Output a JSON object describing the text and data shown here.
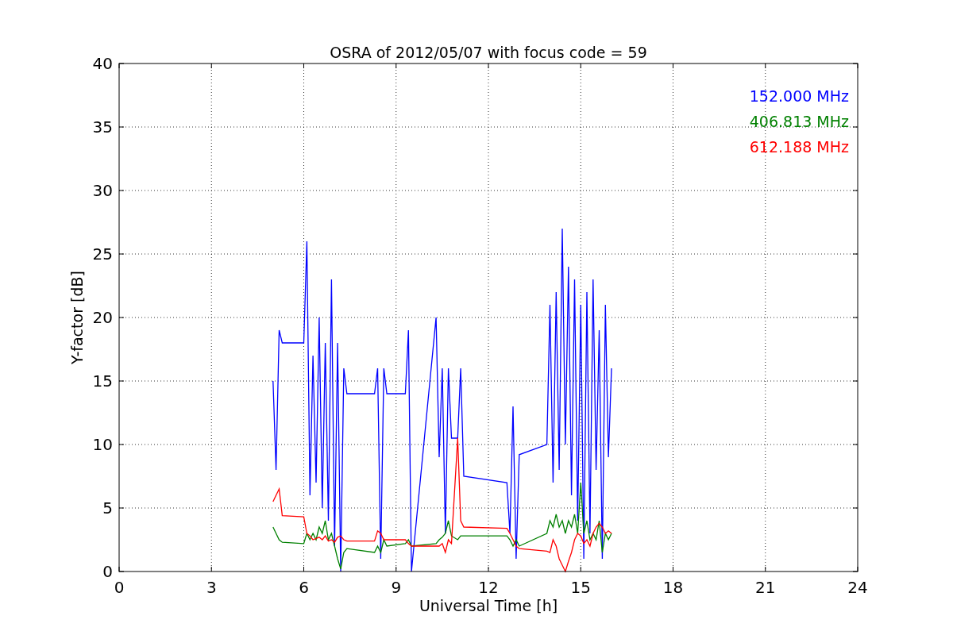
{
  "chart": {
    "chart_data": {
      "type": "line",
      "title": "OSRA of 2012/05/07 with focus code = 59",
      "xlabel": "Universal Time [h]",
      "ylabel": "Y-factor [dB]",
      "x": [
        5.0,
        5.1,
        5.2,
        5.3,
        6.0,
        6.1,
        6.2,
        6.3,
        6.4,
        6.5,
        6.6,
        6.7,
        6.8,
        6.9,
        7.0,
        7.1,
        7.2,
        7.3,
        7.4,
        8.3,
        8.4,
        8.5,
        8.6,
        8.7,
        9.3,
        9.4,
        9.5,
        10.3,
        10.4,
        10.5,
        10.6,
        10.7,
        10.8,
        11.0,
        11.1,
        11.2,
        12.6,
        12.7,
        12.8,
        12.9,
        13.0,
        13.9,
        14.0,
        14.1,
        14.2,
        14.3,
        14.4,
        14.5,
        14.6,
        14.7,
        14.8,
        14.9,
        15.0,
        15.1,
        15.2,
        15.3,
        15.4,
        15.5,
        15.6,
        15.7,
        15.8,
        15.9,
        16.0
      ],
      "series": [
        {
          "name": "152.000 MHz",
          "color": "#0000ff",
          "values": [
            15,
            8,
            19,
            18,
            18,
            26,
            6,
            17,
            7,
            20,
            5,
            18,
            4,
            23,
            2,
            18,
            0,
            16,
            14,
            14,
            16,
            1,
            16,
            14,
            14,
            19,
            0,
            20,
            9,
            16,
            3,
            16,
            10.5,
            10.5,
            16,
            7.5,
            7,
            3,
            13,
            1,
            9.2,
            10,
            21,
            7,
            22,
            8,
            27,
            10,
            24,
            6,
            23,
            4,
            21,
            1,
            22,
            3,
            23,
            8,
            19,
            1,
            21,
            9,
            16
          ]
        },
        {
          "name": "406.813 MHz",
          "color": "#008000",
          "values": [
            3.5,
            3,
            2.5,
            2.3,
            2.2,
            3,
            2.5,
            3,
            2.5,
            3.5,
            3,
            4,
            2.5,
            3,
            2,
            1,
            0.2,
            1.5,
            1.8,
            1.5,
            2,
            1.5,
            2.5,
            2,
            2.2,
            2.5,
            2,
            2.2,
            2.5,
            2.7,
            3,
            4,
            2.8,
            2.5,
            2.8,
            2.8,
            2.8,
            2.5,
            2,
            2.5,
            2,
            3,
            4,
            3.5,
            4.5,
            3.5,
            4,
            3,
            4,
            3.5,
            4.5,
            3,
            7,
            3,
            4,
            2.5,
            3,
            2.5,
            4,
            1.5,
            3,
            2.5,
            3
          ]
        },
        {
          "name": "612.188 MHz",
          "color": "#ff0000",
          "values": [
            5.5,
            6,
            6.5,
            4.4,
            4.3,
            3,
            2.8,
            2.5,
            2.6,
            2.7,
            2.5,
            2.8,
            2.4,
            2.5,
            2.3,
            2.7,
            2.8,
            2.5,
            2.4,
            2.4,
            3.2,
            3,
            2.5,
            2.5,
            2.5,
            2.2,
            2,
            2,
            2,
            2.2,
            1.5,
            2.5,
            2.2,
            10.5,
            4,
            3.5,
            3.4,
            3,
            2.5,
            2,
            1.8,
            1.6,
            1.5,
            2.5,
            2,
            1,
            0.5,
            0,
            0.8,
            1.5,
            2.5,
            3,
            2.8,
            2.2,
            2.5,
            2,
            3,
            3.5,
            3.8,
            3.5,
            3,
            3.2,
            3
          ]
        }
      ],
      "xlim": [
        0,
        24
      ],
      "ylim": [
        0,
        40
      ],
      "xticks": [
        0,
        3,
        6,
        9,
        12,
        15,
        18,
        21,
        24
      ],
      "yticks": [
        0,
        5,
        10,
        15,
        20,
        25,
        30,
        35,
        40
      ],
      "grid": true
    }
  }
}
